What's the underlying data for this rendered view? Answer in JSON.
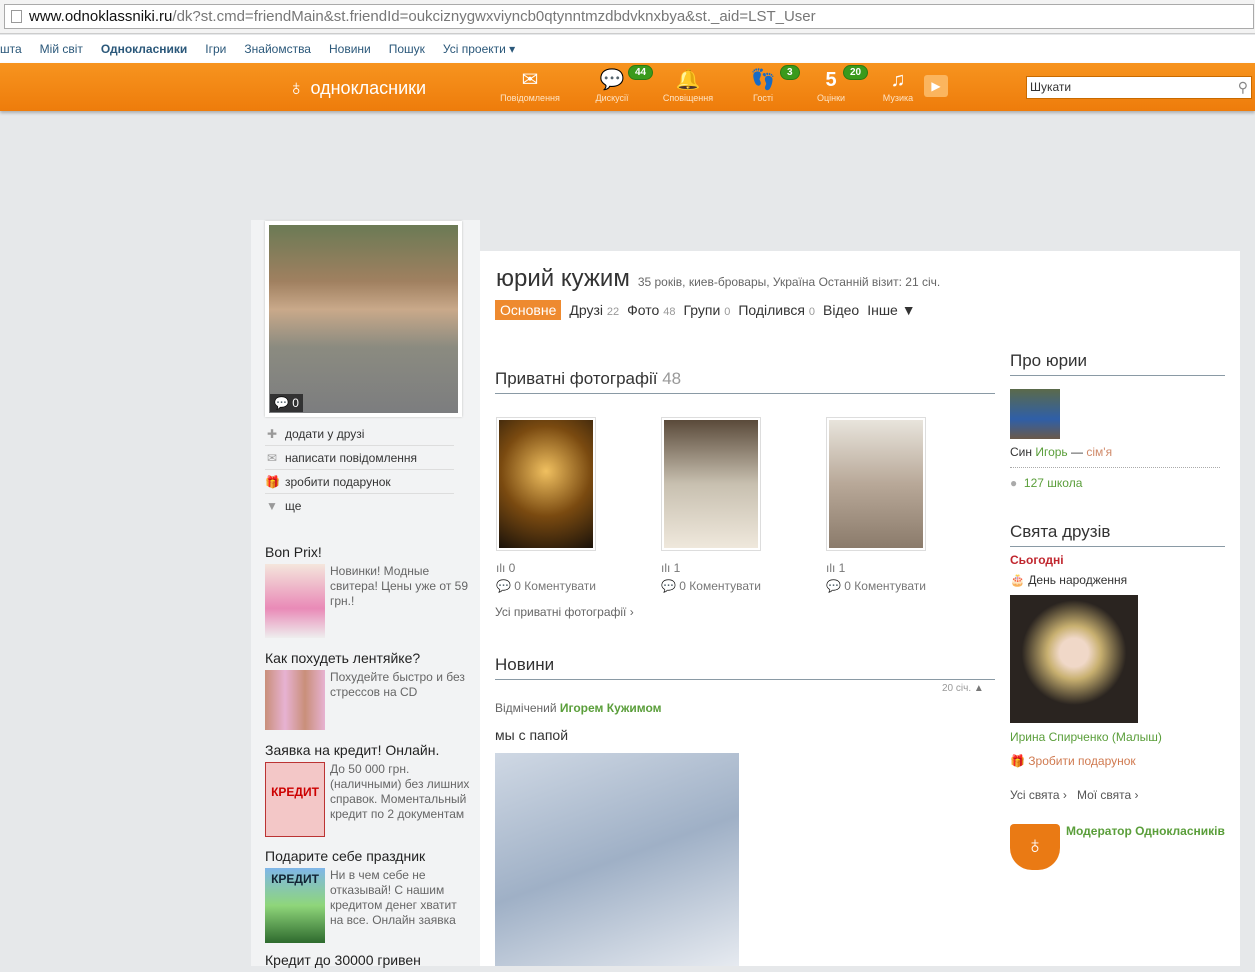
{
  "browser": {
    "url_host": "www.odnoklassniki.ru",
    "url_path": "/dk?st.cmd=friendMain&st.friendId=oukciznygwxviyncb0qtynntmzdbdvknxbya&st._aid=LST_User"
  },
  "topnav": [
    "шта",
    "Мій світ",
    "Однокласники",
    "Ігри",
    "Знайомства",
    "Новини",
    "Пошук",
    "Усі проекти ▾"
  ],
  "toolbar": {
    "logo": "однокласники",
    "items": [
      {
        "label": "Повідомлення",
        "icon": "✉",
        "badge": null
      },
      {
        "label": "Дискусії",
        "icon": "💬",
        "badge": "44"
      },
      {
        "label": "Сповіщення",
        "icon": "🔔",
        "badge": null
      },
      {
        "label": "Гості",
        "icon": "👣",
        "badge": "3"
      },
      {
        "label": "Оцінки",
        "icon": "5",
        "badge": "20"
      },
      {
        "label": "Музика",
        "icon": "♫",
        "badge": null
      }
    ],
    "search_placeholder": "Шукати"
  },
  "profile": {
    "name": "юрий кужим",
    "info": "35 років, киев-бровары, Україна  Останній візит: 21 січ.",
    "avatar_comments": "0",
    "actions": [
      "додати у друзі",
      "написати повідомлення",
      "зробити подарунок",
      "ще"
    ],
    "tabs": [
      {
        "label": "Основне",
        "count": ""
      },
      {
        "label": "Друзі",
        "count": "22"
      },
      {
        "label": "Фото",
        "count": "48"
      },
      {
        "label": "Групи",
        "count": "0"
      },
      {
        "label": "Поділився",
        "count": "0"
      },
      {
        "label": "Відео",
        "count": ""
      },
      {
        "label": "Інше ▼",
        "count": ""
      }
    ]
  },
  "ads": [
    {
      "title": "Bon Prix!",
      "text": "Новинки! Модные свитера! Цены уже от 59 грн.!"
    },
    {
      "title": "Как похудеть лентяйке?",
      "text": "Похудейте быстро и без стрессов на CD"
    },
    {
      "title": "Заявка на кредит! Онлайн.",
      "text": "До 50 000 грн. (наличными) без лишних справок. Моментальный кредит по 2 документам"
    },
    {
      "title": "Подарите себе праздник",
      "text": "Ни в чем себе не отказывай! С нашим кредитом денег хватит на все. Онлайн заявка"
    },
    {
      "title": "Кредит до 30000 гривен",
      "text": ""
    }
  ],
  "photos": {
    "title": "Приватні фотографії",
    "count": "48",
    "items": [
      {
        "views": "0",
        "comments": "0 Коментувати"
      },
      {
        "views": "1",
        "comments": "0 Коментувати"
      },
      {
        "views": "1",
        "comments": "0 Коментувати"
      }
    ],
    "all_link": "Усі приватні фотографії ›"
  },
  "news": {
    "title": "Новини",
    "date": "20 січ.",
    "tagged_prefix": "Відмічений",
    "tagged_by": "Игорем Кужимом",
    "caption": "мы с папой"
  },
  "about": {
    "title": "Про юрии",
    "relation": "Син",
    "relative": "Игорь",
    "relation_type": "сім'я",
    "school": "127 школа"
  },
  "holidays": {
    "title": "Свята друзів",
    "today": "Сьогодні",
    "event": "День народження",
    "friend": "Ирина Спирченко (Малыш)",
    "gift": "Зробити подарунок",
    "all": "Усі свята ›",
    "mine": "Мої свята ›"
  },
  "moderator": "Модератор Однокласників"
}
